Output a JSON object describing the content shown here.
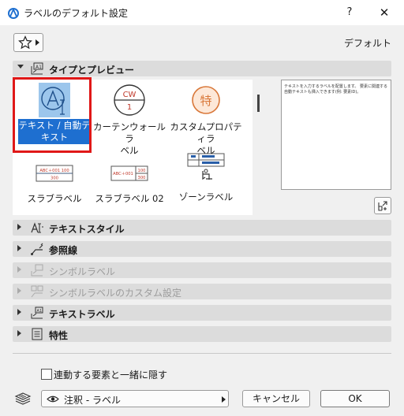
{
  "window": {
    "title": "ラベルのデフォルト設定",
    "help": "?",
    "close": "✕"
  },
  "favorites": {
    "default_label": "デフォルト"
  },
  "sections": {
    "type_preview": "タイプとプレビュー",
    "text_style": "テキストスタイル",
    "pointer": "参照線",
    "symbol_label": "シンボルラベル",
    "symbol_custom": "シンボルラベルのカスタム設定",
    "text_label": "テキストラベル",
    "properties": "特性"
  },
  "label_types": [
    {
      "line1": "テキスト / 自動テ",
      "line2": "キスト",
      "selected": true
    },
    {
      "line1": "カーテンウォールラ",
      "line2": "ベル",
      "icon_text_1": "CW",
      "icon_text_2": "1"
    },
    {
      "line1": "カスタムプロパティラ",
      "line2": "ベル",
      "icon_text": "特"
    },
    {
      "line1": "スラブラベル",
      "icon_text_1": "ABC＋001 100",
      "icon_text_2": "300"
    },
    {
      "line1": "スラブラベル 02",
      "icon_text_1": "ABC＋001",
      "icon_text_2": "100",
      "icon_text_3": "300"
    },
    {
      "line1": "ゾーンラベル"
    }
  ],
  "preview": {
    "text": "テキストを入力するラベルを配置します。 要素に関連する自動テキストも挿入できます(例: 要素ID)。"
  },
  "footer": {
    "hide_checkbox_label": "連動する要素と一緒に隠す",
    "hide_checked": false,
    "layer_value": "注釈 - ラベル",
    "cancel_label": "キャンセル",
    "ok_label": "OK"
  },
  "colors": {
    "selection": "#1e6fd0",
    "highlight_frame": "#e01818",
    "section_bg": "#dcdcdc"
  }
}
